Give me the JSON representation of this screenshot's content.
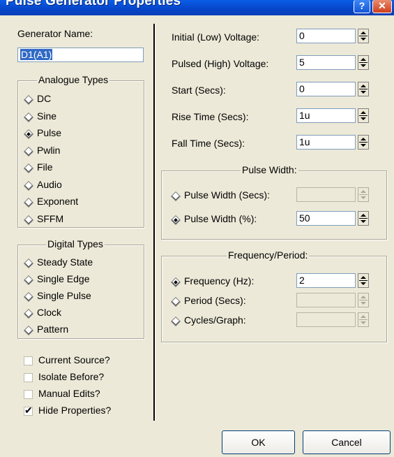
{
  "window": {
    "title": "Pulse Generator Properties",
    "help_label": "?",
    "close_label": "✕"
  },
  "left": {
    "generator_name_label": "Generator Name:",
    "generator_name_value": "D1(A1)",
    "analogue_title": "Analogue Types",
    "analogue_types": [
      {
        "label": "DC",
        "selected": false
      },
      {
        "label": "Sine",
        "selected": false
      },
      {
        "label": "Pulse",
        "selected": true
      },
      {
        "label": "Pwlin",
        "selected": false
      },
      {
        "label": "File",
        "selected": false
      },
      {
        "label": "Audio",
        "selected": false
      },
      {
        "label": "Exponent",
        "selected": false
      },
      {
        "label": "SFFM",
        "selected": false
      }
    ],
    "digital_title": "Digital Types",
    "digital_types": [
      {
        "label": "Steady State",
        "selected": false
      },
      {
        "label": "Single Edge",
        "selected": false
      },
      {
        "label": "Single Pulse",
        "selected": false
      },
      {
        "label": "Clock",
        "selected": false
      },
      {
        "label": "Pattern",
        "selected": false
      }
    ],
    "options": [
      {
        "label": "Current Source?",
        "checked": false
      },
      {
        "label": "Isolate Before?",
        "checked": false
      },
      {
        "label": "Manual Edits?",
        "checked": false
      },
      {
        "label": "Hide Properties?",
        "checked": true
      }
    ]
  },
  "right": {
    "params": [
      {
        "label": "Initial (Low) Voltage:",
        "value": "0"
      },
      {
        "label": "Pulsed (High) Voltage:",
        "value": "5"
      },
      {
        "label": "Start (Secs):",
        "value": "0"
      },
      {
        "label": "Rise Time (Secs):",
        "value": "1u"
      },
      {
        "label": "Fall Time (Secs):",
        "value": "1u"
      }
    ],
    "pulse_width_title": "Pulse Width:",
    "pulse_width": [
      {
        "label": "Pulse Width (Secs):",
        "value": "",
        "selected": false
      },
      {
        "label": "Pulse Width (%):",
        "value": "50",
        "selected": true
      }
    ],
    "freq_title": "Frequency/Period:",
    "freq": [
      {
        "label": "Frequency (Hz):",
        "value": "2",
        "selected": true
      },
      {
        "label": "Period (Secs):",
        "value": "",
        "selected": false
      },
      {
        "label": "Cycles/Graph:",
        "value": "",
        "selected": false
      }
    ]
  },
  "buttons": {
    "ok": "OK",
    "cancel": "Cancel"
  }
}
